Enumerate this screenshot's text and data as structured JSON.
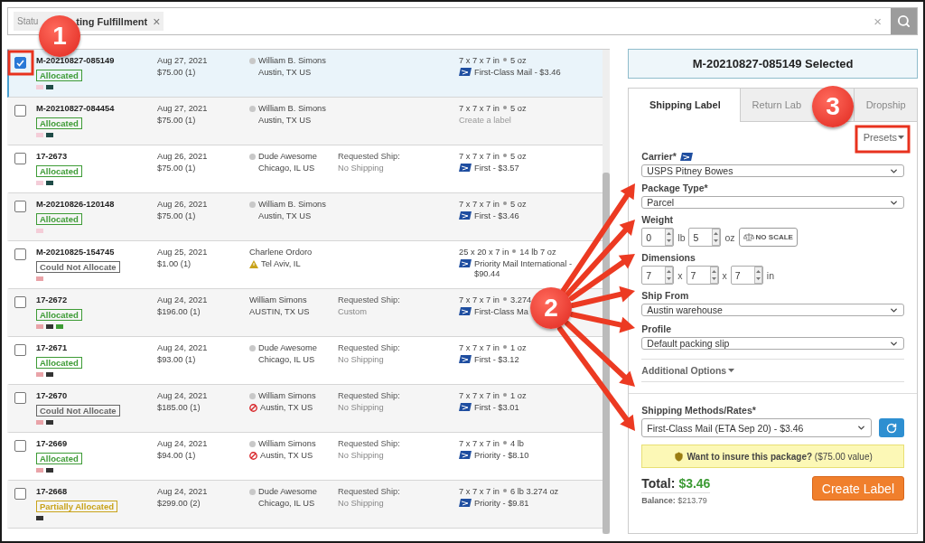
{
  "search": {
    "chip_label": "Statu",
    "chip_value": "ting Fulfillment",
    "chip_remove": "×",
    "clear": "×"
  },
  "orders": [
    {
      "id": "M-20210827-085149",
      "selected": true,
      "status": {
        "kind": "allocated",
        "label": "Allocated"
      },
      "tags": [
        {
          "color": "#f4cdd8"
        },
        {
          "color": "#1f4b47"
        }
      ],
      "date": "Aug 27, 2021",
      "total": "$75.00 (1)",
      "customer": {
        "name": "William B. Simons",
        "city": "Austin, TX US",
        "dot": true,
        "kind": "plain"
      },
      "package": {
        "dims": "7 x 7 x 7 in",
        "weight": "5 oz"
      },
      "rate": {
        "kind": "rate",
        "text": "First-Class Mail - $3.46"
      }
    },
    {
      "id": "M-20210827-084454",
      "selected": false,
      "status": {
        "kind": "allocated",
        "label": "Allocated"
      },
      "tags": [
        {
          "color": "#f4cdd8"
        },
        {
          "color": "#1f4b47"
        }
      ],
      "date": "Aug 27, 2021",
      "total": "$75.00 (1)",
      "customer": {
        "name": "William B. Simons",
        "city": "Austin, TX US",
        "dot": true,
        "kind": "plain"
      },
      "package": {
        "dims": "7 x 7 x 7 in",
        "weight": "5 oz"
      },
      "rate": {
        "kind": "prompt",
        "text": "Create a label"
      }
    },
    {
      "id": "17-2673",
      "selected": false,
      "status": {
        "kind": "allocated",
        "label": "Allocated"
      },
      "tags": [
        {
          "color": "#f4cdd8"
        },
        {
          "color": "#1f4b47"
        }
      ],
      "date": "Aug 26, 2021",
      "total": "$75.00 (1)",
      "customer": {
        "name": "Dude Awesome",
        "city": "Chicago, IL US",
        "dot": true,
        "kind": "plain"
      },
      "requested": {
        "label": "Requested Ship:",
        "value": "No Shipping"
      },
      "package": {
        "dims": "7 x 7 x 7 in",
        "weight": "5 oz"
      },
      "rate": {
        "kind": "rate",
        "text": "First - $3.57"
      }
    },
    {
      "id": "M-20210826-120148",
      "selected": false,
      "status": {
        "kind": "allocated",
        "label": "Allocated"
      },
      "tags": [
        {
          "color": "#f4cdd8"
        }
      ],
      "date": "Aug 26, 2021",
      "total": "$75.00 (1)",
      "customer": {
        "name": "William B. Simons",
        "city": "Austin, TX US",
        "dot": true,
        "kind": "plain"
      },
      "package": {
        "dims": "7 x 7 x 7 in",
        "weight": "5 oz"
      },
      "rate": {
        "kind": "rate",
        "text": "First - $3.46"
      }
    },
    {
      "id": "M-20210825-154745",
      "selected": false,
      "status": {
        "kind": "unallocated",
        "label": "Could Not Allocate"
      },
      "tags": [
        {
          "color": "#e9a3a8"
        }
      ],
      "date": "Aug 25, 2021",
      "total": "$1.00 (1)",
      "customer": {
        "name": "Charlene Ordoro",
        "city": "Tel Aviv, IL",
        "dot": false,
        "kind": "warning"
      },
      "package": {
        "dims": "25 x 20 x 7 in",
        "weight": "14 lb  7 oz"
      },
      "rate": {
        "kind": "rate",
        "text": "Priority Mail International - $90.44"
      }
    },
    {
      "id": "17-2672",
      "selected": false,
      "status": {
        "kind": "allocated",
        "label": "Allocated"
      },
      "tags": [
        {
          "color": "#e9a3a8"
        },
        {
          "color": "#333333"
        },
        {
          "color": "#3d9b35"
        }
      ],
      "date": "Aug 24, 2021",
      "total": "$196.00 (1)",
      "customer": {
        "name": "William Simons",
        "city": "AUSTIN, TX US",
        "dot": false,
        "kind": "plain"
      },
      "requested": {
        "label": "Requested Ship:",
        "value": "Custom"
      },
      "package": {
        "dims": "7 x 7 x 7 in",
        "weight": "3.274"
      },
      "rate": {
        "kind": "rate",
        "text": "First-Class Ma"
      }
    },
    {
      "id": "17-2671",
      "selected": false,
      "status": {
        "kind": "allocated",
        "label": "Allocated"
      },
      "tags": [
        {
          "color": "#e9a3a8"
        },
        {
          "color": "#333333"
        }
      ],
      "date": "Aug 24, 2021",
      "total": "$93.00 (1)",
      "customer": {
        "name": "Dude Awesome",
        "city": "Chicago, IL US",
        "dot": true,
        "kind": "plain"
      },
      "requested": {
        "label": "Requested Ship:",
        "value": "No Shipping"
      },
      "package": {
        "dims": "7 x 7 x 7 in",
        "weight": "1 oz"
      },
      "rate": {
        "kind": "rate",
        "text": "First - $3.12"
      }
    },
    {
      "id": "17-2670",
      "selected": false,
      "status": {
        "kind": "unallocated",
        "label": "Could Not Allocate"
      },
      "tags": [
        {
          "color": "#e9a3a8"
        },
        {
          "color": "#333333"
        }
      ],
      "date": "Aug 24, 2021",
      "total": "$185.00 (1)",
      "customer": {
        "name": "William Simons",
        "city": "Austin, TX US",
        "dot": true,
        "kind": "blocked"
      },
      "requested": {
        "label": "Requested Ship:",
        "value": "No Shipping"
      },
      "package": {
        "dims": "7 x 7 x 7 in",
        "weight": "1 oz"
      },
      "rate": {
        "kind": "rate",
        "text": "First - $3.01"
      }
    },
    {
      "id": "17-2669",
      "selected": false,
      "status": {
        "kind": "allocated",
        "label": "Allocated"
      },
      "tags": [
        {
          "color": "#e9a3a8"
        },
        {
          "color": "#333333"
        }
      ],
      "date": "Aug 24, 2021",
      "total": "$94.00 (1)",
      "customer": {
        "name": "William Simons",
        "city": "Austin, TX US",
        "dot": true,
        "kind": "blocked"
      },
      "requested": {
        "label": "Requested Ship:",
        "value": "No Shipping"
      },
      "package": {
        "dims": "7 x 7 x 7 in",
        "weight": "4 lb"
      },
      "rate": {
        "kind": "rate",
        "text": "Priority - $8.10"
      }
    },
    {
      "id": "17-2668",
      "selected": false,
      "status": {
        "kind": "partial",
        "label": "Partially Allocated"
      },
      "tags": [
        {
          "color": "#333333"
        }
      ],
      "date": "Aug 24, 2021",
      "total": "$299.00 (2)",
      "customer": {
        "name": "Dude Awesome",
        "city": "Chicago, IL US",
        "dot": true,
        "kind": "plain"
      },
      "requested": {
        "label": "Requested Ship:",
        "value": "No Shipping"
      },
      "package": {
        "dims": "7 x 7 x 7 in",
        "weight": "6 lb  3.274 oz"
      },
      "rate": {
        "kind": "rate",
        "text": "Priority - $9.81"
      }
    }
  ],
  "detail": {
    "title": "M-20210827-085149 Selected",
    "tabs": [
      {
        "label": "Shipping Label",
        "selected": true
      },
      {
        "label": "Return Lab",
        "selected": false
      },
      {
        "label": "Dropship",
        "selected": false
      }
    ],
    "presets": "Presets",
    "carrier": {
      "label": "Carrier*",
      "value": "USPS Pitney Bowes"
    },
    "package_type": {
      "label": "Package Type*",
      "value": "Parcel"
    },
    "weight": {
      "label": "Weight",
      "lb": "0",
      "lb_unit": "lb",
      "oz": "5",
      "oz_unit": "oz",
      "scale_button": "NO SCALE"
    },
    "dimensions": {
      "label": "Dimensions",
      "values": [
        "7",
        "7",
        "7"
      ],
      "separators": [
        "x",
        "x"
      ],
      "unit": "in"
    },
    "ship_from": {
      "label": "Ship From",
      "value": "Austin warehouse"
    },
    "profile": {
      "label": "Profile",
      "value": "Default packing slip"
    },
    "additional_options": "Additional Options",
    "rates": {
      "label": "Shipping Methods/Rates*",
      "value": "First-Class Mail (ETA Sep 20) - $3.46"
    },
    "insure": "**Want to insure this package?** ($75.00 value)",
    "total": {
      "label": "Total:",
      "amount": "$3.46",
      "balance": "**Balance:** $213.79"
    },
    "create_button": "Create Label"
  },
  "callouts": [
    "1",
    "2",
    "3"
  ]
}
